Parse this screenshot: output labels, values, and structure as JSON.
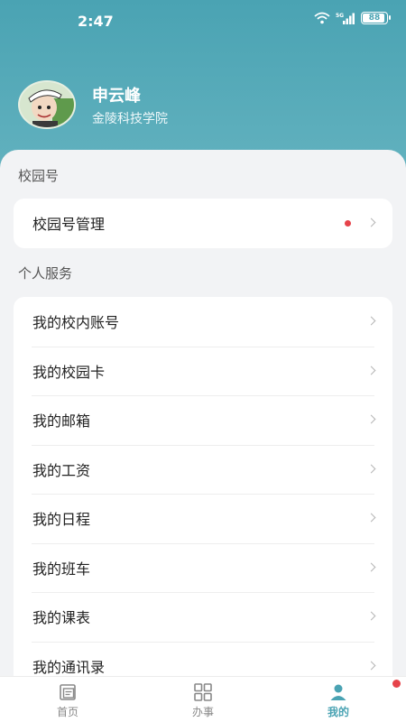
{
  "status_bar": {
    "time": "2:47",
    "network": "5G",
    "battery": "88"
  },
  "profile": {
    "name": "申云峰",
    "org": "金陵科技学院"
  },
  "sections": [
    {
      "title": "校园号",
      "items": [
        {
          "label": "校园号管理",
          "has_dot": true
        }
      ]
    },
    {
      "title": "个人服务",
      "items": [
        {
          "label": "我的校内账号"
        },
        {
          "label": "我的校园卡"
        },
        {
          "label": "我的邮箱"
        },
        {
          "label": "我的工资"
        },
        {
          "label": "我的日程"
        },
        {
          "label": "我的班车"
        },
        {
          "label": "我的课表"
        },
        {
          "label": "我的通讯录"
        }
      ]
    }
  ],
  "tabbar": [
    {
      "label": "首页",
      "icon": "home-icon",
      "active": false
    },
    {
      "label": "办事",
      "icon": "grid-icon",
      "active": false
    },
    {
      "label": "我的",
      "icon": "user-icon",
      "active": true,
      "badge_dot": true
    }
  ],
  "colors": {
    "accent": "#4aa3b3",
    "badge": "#e6434a",
    "background": "#f2f3f5"
  }
}
